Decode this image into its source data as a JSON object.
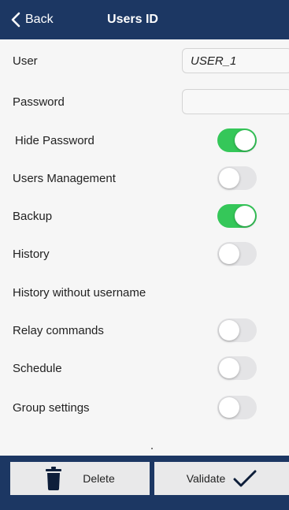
{
  "header": {
    "back_label": "Back",
    "title": "Users ID"
  },
  "form": {
    "user": {
      "label": "User",
      "value": "USER_1"
    },
    "password": {
      "label": "Password",
      "value": ""
    },
    "toggles": [
      {
        "label": "Hide Password",
        "on": true
      },
      {
        "label": "Users Management",
        "on": false
      },
      {
        "label": "Backup",
        "on": true
      },
      {
        "label": "History",
        "on": false
      },
      {
        "label": "History without username",
        "on": null
      },
      {
        "label": "Relay commands",
        "on": false
      },
      {
        "label": "Schedule",
        "on": false
      },
      {
        "label": "Group settings",
        "on": false
      }
    ]
  },
  "footer": {
    "delete_label": "Delete",
    "validate_label": "Validate"
  },
  "icons": {
    "back": "chevron-left-icon",
    "delete": "trash-icon",
    "validate": "checkmark-icon"
  },
  "colors": {
    "navbar": "#1c3763",
    "toggle_on": "#35c759",
    "toggle_off": "#e4e4e6"
  }
}
